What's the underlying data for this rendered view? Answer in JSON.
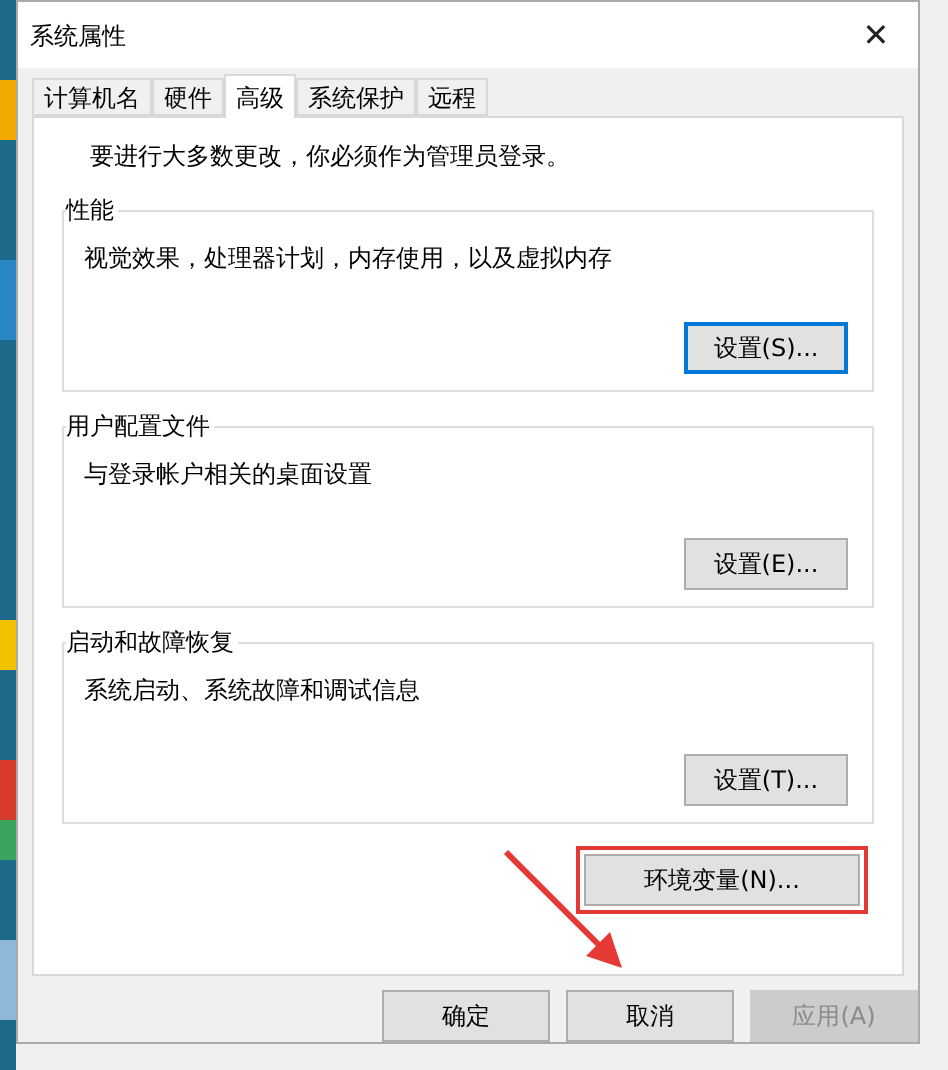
{
  "window": {
    "title": "系统属性",
    "close": "✕"
  },
  "tabs": [
    {
      "label": "计算机名",
      "selected": false
    },
    {
      "label": "硬件",
      "selected": false
    },
    {
      "label": "高级",
      "selected": true
    },
    {
      "label": "系统保护",
      "selected": false
    },
    {
      "label": "远程",
      "selected": false
    }
  ],
  "notice": "要进行大多数更改，你必须作为管理员登录。",
  "groups": [
    {
      "title": "性能",
      "description": "视觉效果，处理器计划，内存使用，以及虚拟内存",
      "button": "设置(S)...",
      "focused": true
    },
    {
      "title": "用户配置文件",
      "description": "与登录帐户相关的桌面设置",
      "button": "设置(E)...",
      "focused": false
    },
    {
      "title": "启动和故障恢复",
      "description": "系统启动、系统故障和调试信息",
      "button": "设置(T)...",
      "focused": false
    }
  ],
  "env_button": {
    "label": "环境变量(N)...",
    "highlighted": true
  },
  "footer_buttons": [
    {
      "label": "确定",
      "disabled": false
    },
    {
      "label": "取消",
      "disabled": false
    },
    {
      "label": "应用(A)",
      "disabled": true
    }
  ]
}
